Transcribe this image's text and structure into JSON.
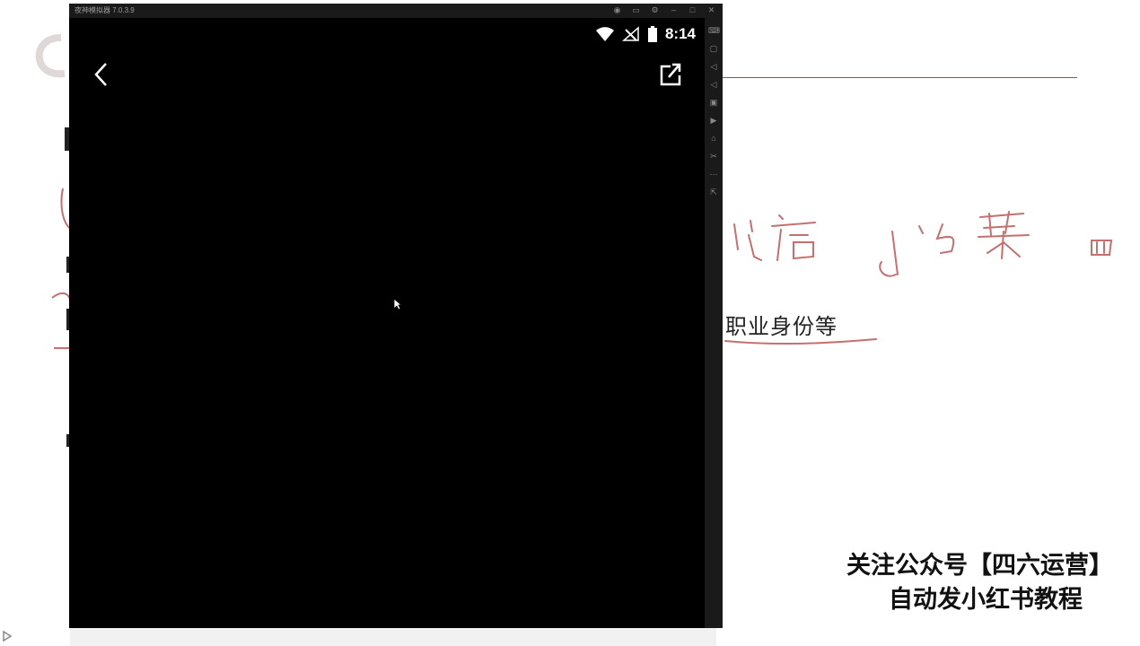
{
  "slide": {
    "body_text": "职业身份等",
    "watermark_line1": "关注公众号【四六运营】",
    "watermark_line2": "自动发小红书教程"
  },
  "emulator": {
    "title": "夜神模拟器 7.0.3.9",
    "status_time": "8:14",
    "controls": [
      "pin",
      "minimize-all",
      "settings",
      "minimize",
      "maximize",
      "close"
    ],
    "sidebar_tools": [
      "keyboard-icon",
      "volume-up-icon",
      "volume-down-icon",
      "screenshot-icon",
      "record-icon",
      "apk-icon",
      "cut-icon",
      "more-icon",
      "exit-icon"
    ]
  }
}
